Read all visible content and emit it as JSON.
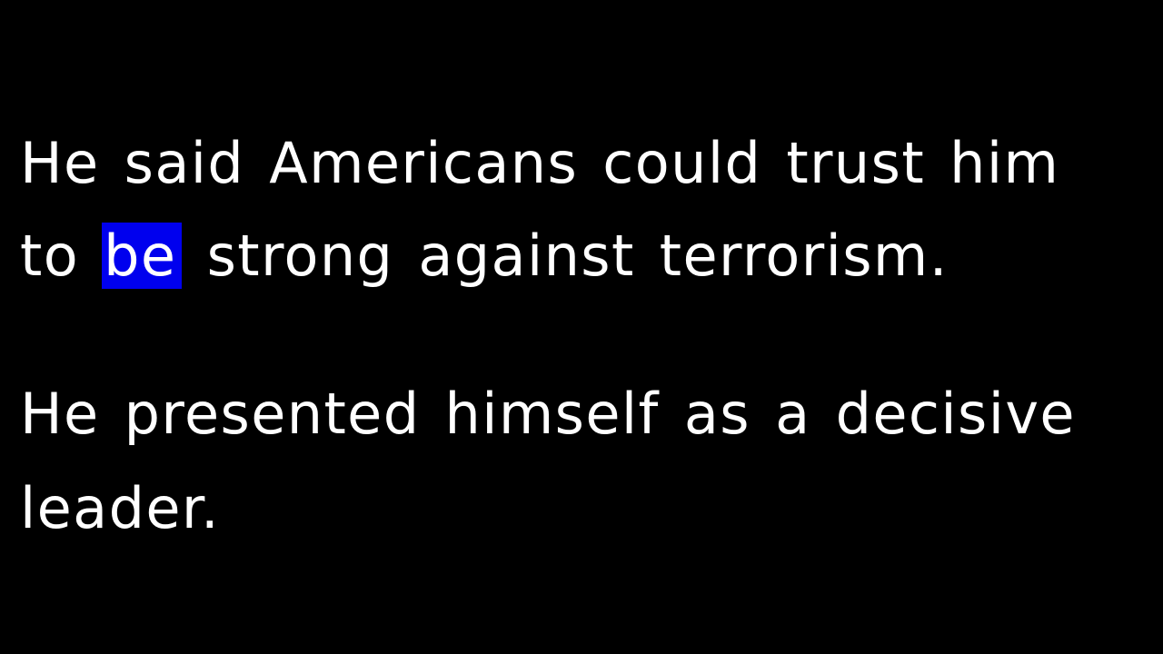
{
  "background_color": "#000000",
  "text_color": "#ffffff",
  "highlight_color": "#0000ee",
  "caption": {
    "sentence_1": {
      "line_1": "He said Americans could trust him",
      "line_2_before": "to ",
      "line_2_highlight": "be",
      "line_2_after": " strong against terrorism."
    },
    "sentence_2": {
      "line_1": "He presented himself as a decisive",
      "line_2": "leader."
    }
  }
}
